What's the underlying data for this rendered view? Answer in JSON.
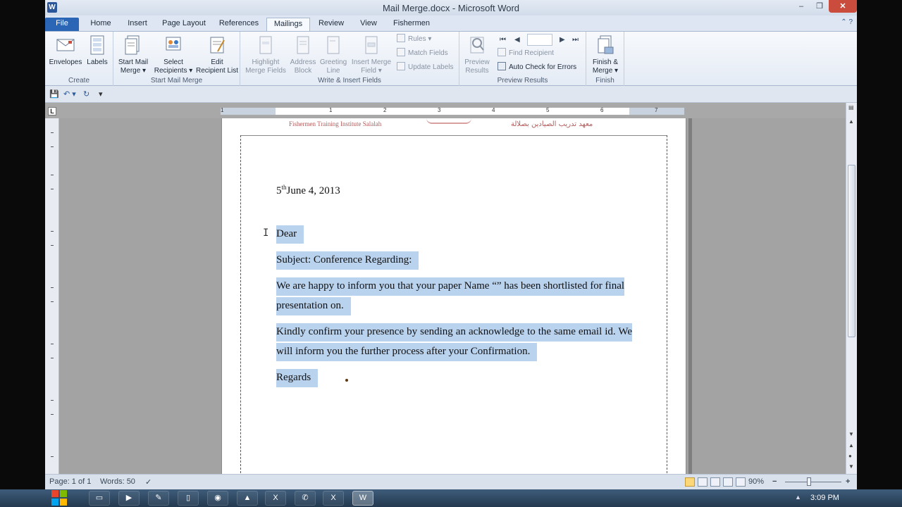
{
  "window": {
    "title": "Mail Merge.docx - Microsoft Word",
    "min": "–",
    "max": "❐",
    "close": "✕"
  },
  "tabs": [
    {
      "label": "File"
    },
    {
      "label": "Home"
    },
    {
      "label": "Insert"
    },
    {
      "label": "Page Layout"
    },
    {
      "label": "References"
    },
    {
      "label": "Mailings"
    },
    {
      "label": "Review"
    },
    {
      "label": "View"
    },
    {
      "label": "Fishermen"
    }
  ],
  "ribbon": {
    "create": {
      "label": "Create",
      "envelopes": "Envelopes",
      "labels": "Labels"
    },
    "start": {
      "label": "Start Mail Merge",
      "start_line1": "Start Mail",
      "start_line2": "Merge ▾",
      "select_line1": "Select",
      "select_line2": "Recipients ▾",
      "edit_line1": "Edit",
      "edit_line2": "Recipient List"
    },
    "write": {
      "label": "Write & Insert Fields",
      "highlight_line1": "Highlight",
      "highlight_line2": "Merge Fields",
      "address_line1": "Address",
      "address_line2": "Block",
      "greeting_line1": "Greeting",
      "greeting_line2": "Line",
      "insert_line1": "Insert Merge",
      "insert_line2": "Field ▾",
      "rules": "Rules ▾",
      "match": "Match Fields",
      "update": "Update Labels"
    },
    "preview": {
      "label": "Preview Results",
      "preview_line1": "Preview",
      "preview_line2": "Results",
      "find": "Find Recipient",
      "check": "Auto Check for Errors",
      "first": "⏮",
      "prev": "◀",
      "next": "▶",
      "last": "⏭"
    },
    "finish": {
      "label": "Finish",
      "finish_line1": "Finish &",
      "finish_line2": "Merge ▾"
    }
  },
  "qat": {
    "save": "💾",
    "undo": "↶ ▾",
    "redo": "↻",
    "customize": "▾"
  },
  "ruler": {
    "numbers": [
      "1",
      "1",
      "2",
      "3",
      "4",
      "5",
      "6",
      "7"
    ]
  },
  "document": {
    "header_left": "Fishermen Training Institute Salalah",
    "header_right": "معهد تدريب الصيادين بصلالة",
    "date_prefix": "5",
    "date_sup": "th",
    "date_rest": "June 4, 2013",
    "dear": "Dear",
    "subject": "Subject: Conference Regarding:",
    "happy": "We are happy to inform you that your paper Name “” has been shortlisted for final presentation on.",
    "kindly": "Kindly confirm your presence by sending an acknowledge to the same email id. We will inform you the further process after your Confirmation.",
    "regards": "Regards"
  },
  "status": {
    "page": "Page: 1 of 1",
    "words": "Words: 50",
    "zoom": "90%",
    "zoom_minus": "−",
    "zoom_plus": "+"
  },
  "taskbar": {
    "time": "3:09 PM"
  }
}
